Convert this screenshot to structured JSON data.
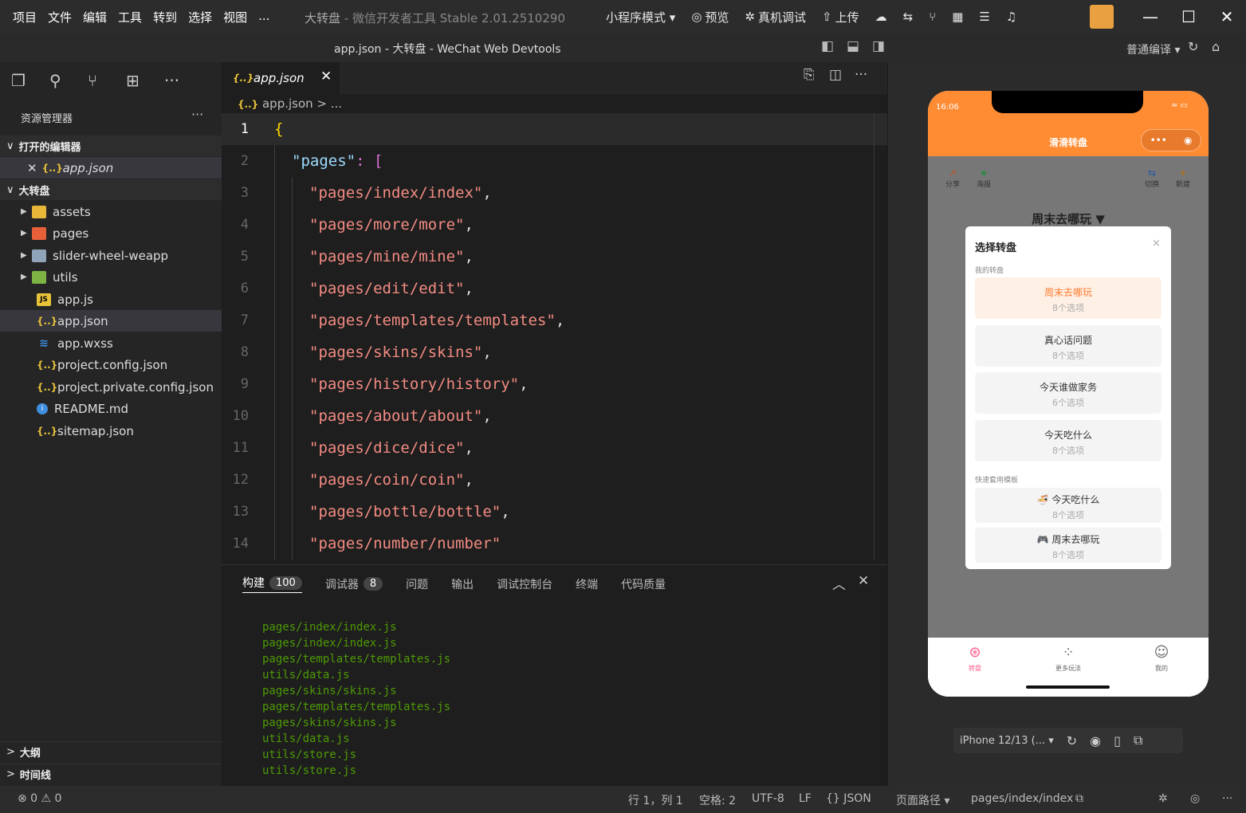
{
  "menu": [
    "项目",
    "文件",
    "编辑",
    "工具",
    "转到",
    "选择",
    "视图",
    "..."
  ],
  "app_title": "大转盘",
  "app_subtitle": " - 微信开发者工具 Stable 2.01.2510290",
  "toolbar": {
    "mode": "小程序模式 ▾",
    "preview": "预览",
    "real_debug": "真机调试",
    "upload": "上传"
  },
  "window_title": "app.json - 大转盘 - WeChat Web Devtools",
  "compile_mode": "普通编译 ▾",
  "explorer": {
    "title": "资源管理器",
    "more": "···",
    "open_editors": "打开的编辑器",
    "open_file": "app.json",
    "project": "大转盘",
    "items": [
      {
        "name": "assets",
        "type": "folder"
      },
      {
        "name": "pages",
        "type": "folder"
      },
      {
        "name": "slider-wheel-weapp",
        "type": "folder"
      },
      {
        "name": "utils",
        "type": "folder"
      },
      {
        "name": "app.js",
        "type": "js"
      },
      {
        "name": "app.json",
        "type": "json"
      },
      {
        "name": "app.wxss",
        "type": "css"
      },
      {
        "name": "project.config.json",
        "type": "json"
      },
      {
        "name": "project.private.config.json",
        "type": "json"
      },
      {
        "name": "README.md",
        "type": "md"
      },
      {
        "name": "sitemap.json",
        "type": "json"
      }
    ],
    "outline": "大纲",
    "timeline": "时间线"
  },
  "editor": {
    "tab": "app.json",
    "breadcrumb": "app.json > ...",
    "lines": [
      {
        "n": "1",
        "text": "{"
      },
      {
        "n": "2",
        "key": "\"pages\"",
        "rest": ": ["
      },
      {
        "n": "3",
        "str": "\"pages/index/index\"",
        "end": ","
      },
      {
        "n": "4",
        "str": "\"pages/more/more\"",
        "end": ","
      },
      {
        "n": "5",
        "str": "\"pages/mine/mine\"",
        "end": ","
      },
      {
        "n": "6",
        "str": "\"pages/edit/edit\"",
        "end": ","
      },
      {
        "n": "7",
        "str": "\"pages/templates/templates\"",
        "end": ","
      },
      {
        "n": "8",
        "str": "\"pages/skins/skins\"",
        "end": ","
      },
      {
        "n": "9",
        "str": "\"pages/history/history\"",
        "end": ","
      },
      {
        "n": "10",
        "str": "\"pages/about/about\"",
        "end": ","
      },
      {
        "n": "11",
        "str": "\"pages/dice/dice\"",
        "end": ","
      },
      {
        "n": "12",
        "str": "\"pages/coin/coin\"",
        "end": ","
      },
      {
        "n": "13",
        "str": "\"pages/bottle/bottle\"",
        "end": ","
      },
      {
        "n": "14",
        "str": "\"pages/number/number\"",
        "end": ""
      }
    ]
  },
  "panel": {
    "tabs": [
      {
        "label": "构建",
        "badge": "100"
      },
      {
        "label": "调试器",
        "badge": "8"
      },
      {
        "label": "问题"
      },
      {
        "label": "输出"
      },
      {
        "label": "调试控制台"
      },
      {
        "label": "终端"
      },
      {
        "label": "代码质量"
      }
    ],
    "log": [
      "pages/index/index.js",
      "pages/index/index.js",
      "pages/templates/templates.js",
      "utils/data.js",
      "pages/skins/skins.js",
      "pages/templates/templates.js",
      "pages/skins/skins.js",
      "utils/data.js",
      "utils/store.js",
      "utils/store.js"
    ]
  },
  "phone": {
    "time": "16:06",
    "nav_title": "滑滑转盘",
    "quick": [
      "分享",
      "海报",
      "切换",
      "新建"
    ],
    "wheel_title": "周末去哪玩  ▼",
    "modal": {
      "title": "选择转盘",
      "close": "×",
      "my_label": "我的转盘",
      "my": [
        {
          "name": "周末去哪玩",
          "count": "8个选项"
        },
        {
          "name": "真心话问题",
          "count": "8个选项"
        },
        {
          "name": "今天谁做家务",
          "count": "6个选项"
        },
        {
          "name": "今天吃什么",
          "count": "8个选项"
        }
      ],
      "tpl_label": "快速套用模板",
      "templates": [
        {
          "name": "🍜 今天吃什么",
          "count": "8个选项"
        },
        {
          "name": "🎮 周末去哪玩",
          "count": "8个选项"
        }
      ]
    },
    "tabbar": [
      "转盘",
      "更多玩法",
      "我的"
    ]
  },
  "device": "iPhone 12/13 (... ▾",
  "statusbar": {
    "errors": "⊗ 0  ⚠ 0",
    "pos": "行 1，列 1",
    "spaces": "空格: 2",
    "enc": "UTF-8",
    "eol": "LF",
    "lang": "{} JSON",
    "path_label": "页面路径 ▾",
    "path": "pages/index/index"
  }
}
